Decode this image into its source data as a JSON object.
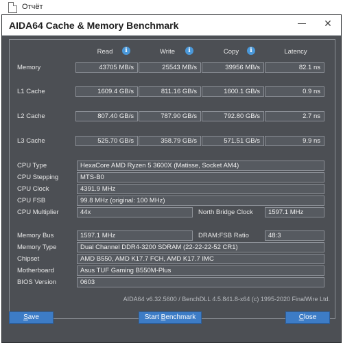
{
  "background": {
    "doc_label": "Отчёт"
  },
  "window": {
    "title": "AIDA64 Cache & Memory Benchmark",
    "close_glyph": "✕"
  },
  "columns": {
    "read": "Read",
    "write": "Write",
    "copy": "Copy",
    "latency": "Latency"
  },
  "benchmark_rows": [
    {
      "label": "Memory",
      "read": "43705 MB/s",
      "write": "25543 MB/s",
      "copy": "39956 MB/s",
      "latency": "82.1 ns"
    },
    {
      "label": "L1 Cache",
      "read": "1609.4 GB/s",
      "write": "811.16 GB/s",
      "copy": "1600.1 GB/s",
      "latency": "0.9 ns"
    },
    {
      "label": "L2 Cache",
      "read": "807.40 GB/s",
      "write": "787.90 GB/s",
      "copy": "792.80 GB/s",
      "latency": "2.7 ns"
    },
    {
      "label": "L3 Cache",
      "read": "525.70 GB/s",
      "write": "358.79 GB/s",
      "copy": "571.51 GB/s",
      "latency": "9.9 ns"
    }
  ],
  "cpu": {
    "type_label": "CPU Type",
    "type_value": "HexaCore AMD Ryzen 5 3600X  (Matisse, Socket AM4)",
    "stepping_label": "CPU Stepping",
    "stepping_value": "MTS-B0",
    "clock_label": "CPU Clock",
    "clock_value": "4391.9 MHz",
    "fsb_label": "CPU FSB",
    "fsb_value": "99.8 MHz  (original: 100 MHz)",
    "multiplier_label": "CPU Multiplier",
    "multiplier_value": "44x",
    "nb_clock_label": "North Bridge Clock",
    "nb_clock_value": "1597.1 MHz"
  },
  "memory": {
    "bus_label": "Memory Bus",
    "bus_value": "1597.1 MHz",
    "ratio_label": "DRAM:FSB Ratio",
    "ratio_value": "48:3",
    "type_label": "Memory Type",
    "type_value": "Dual Channel DDR4-3200 SDRAM  (22-22-22-52 CR1)",
    "chipset_label": "Chipset",
    "chipset_value": "AMD B550, AMD K17.7 FCH, AMD K17.7 IMC",
    "motherboard_label": "Motherboard",
    "motherboard_value": "Asus TUF Gaming B550M-Plus",
    "bios_label": "BIOS Version",
    "bios_value": "0603"
  },
  "footer": "AIDA64 v6.32.5600 / BenchDLL 4.5.841.8-x64  (c) 1995-2020 FinalWire Ltd.",
  "buttons": {
    "save_first": "S",
    "save_rest": "ave",
    "start_pre": "Start ",
    "start_ul": "B",
    "start_post": "enchmark",
    "close_first": "C",
    "close_rest": "lose"
  },
  "colors": {
    "window_bg": "#4c4f54",
    "field_bg": "#565a60",
    "button_bg": "#3d7cc6",
    "info_icon": "#4a98d9"
  }
}
